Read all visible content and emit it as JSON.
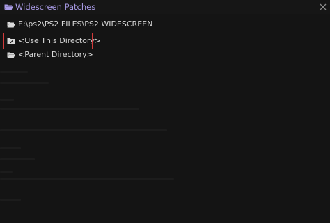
{
  "window": {
    "title": "Widescreen Patches",
    "title_icon": "folder-open-icon",
    "close_icon": "close-icon",
    "accent_color": "#a99be6"
  },
  "browser": {
    "current_path": "E:\\ps2\\PS2 FILES\\PS2 WIDESCREEN",
    "items": [
      {
        "label": "<Use This Directory>",
        "icon": "folder-check-icon",
        "highlighted": true
      },
      {
        "label": "<Parent Directory>",
        "icon": "folder-open-icon",
        "highlighted": false
      }
    ],
    "highlight_color": "#d23a3a"
  }
}
